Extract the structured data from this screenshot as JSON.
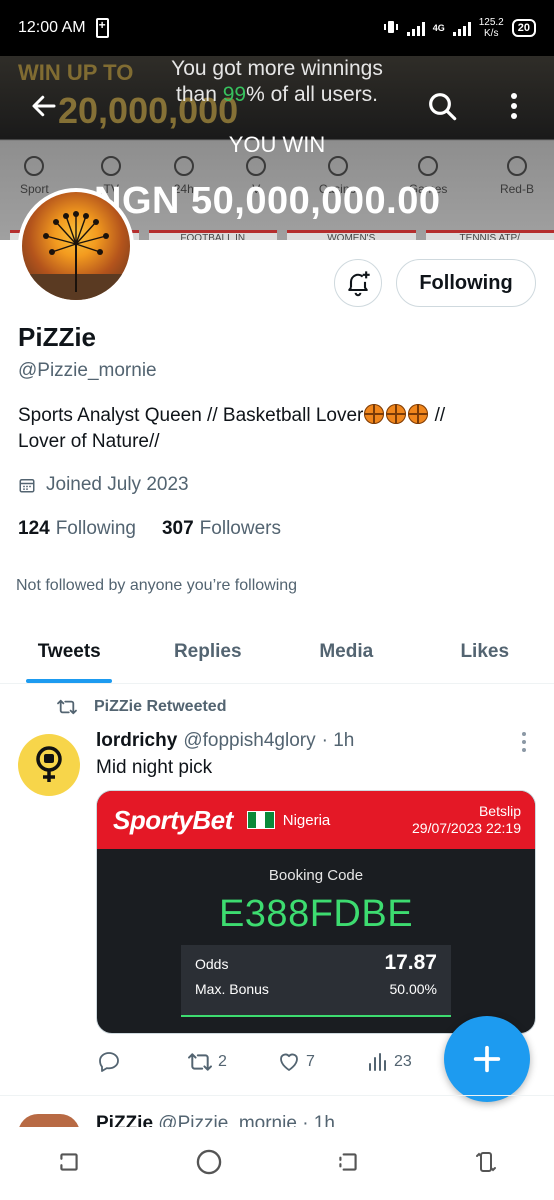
{
  "status": {
    "time": "12:00 AM",
    "network": "4G",
    "speed_value": "125.2",
    "speed_unit": "K/s",
    "battery": "20"
  },
  "banner": {
    "promo_top": "WIN UP TO",
    "promo_big": "20,000,000",
    "message_line1": "You got more winnings",
    "message_prefix": "than ",
    "message_pct": "99",
    "message_suffix": "% of all users.",
    "you_win": "YOU WIN",
    "amount": "NGN 50,000,000.00",
    "categories": [
      "Sport",
      "TV",
      "24h",
      "V",
      "Casino",
      "Games",
      "Red-B"
    ],
    "tabs": [
      "",
      "FOOTBALL IN",
      "WOMEN'S",
      "TENNIS ATP/"
    ]
  },
  "profile": {
    "name": "PiZZie",
    "handle": "@Pizzie_mornie",
    "bio_line1": "Sports Analyst Queen // Basketball Lover",
    "bio_after_emoji": " //",
    "bio_line2": "Lover of Nature//",
    "joined": "Joined July 2023",
    "following_count": "124",
    "following_label": "Following",
    "followers_count": "307",
    "followers_label": "Followers",
    "mutuals": "Not followed by anyone you’re following",
    "follow_button": "Following"
  },
  "tabs": [
    "Tweets",
    "Replies",
    "Media",
    "Likes"
  ],
  "tweet": {
    "retweet_label": "PiZZie Retweeted",
    "username": "lordrichy",
    "handle": "@foppish4glory",
    "time": "· 1h",
    "text": "Mid night pick",
    "card": {
      "brand": "SportyBet",
      "country": "Nigeria",
      "slip_label": "Betslip",
      "slip_date": "29/07/2023 22:19",
      "booking_label": "Booking Code",
      "booking_code": "E388FDBE",
      "odds_label": "Odds",
      "odds_value": "17.87",
      "bonus_label": "Max. Bonus",
      "bonus_value": "50.00%"
    },
    "retweets": "2",
    "likes": "7",
    "views": "23"
  },
  "next_tweet": {
    "username": "PiZZie",
    "handle": "@Pizzie_mornie",
    "time": "· 1h"
  },
  "colors": {
    "accent": "#1d9bf0",
    "sportybet_red": "#e41826",
    "code_green": "#3ddc70"
  }
}
